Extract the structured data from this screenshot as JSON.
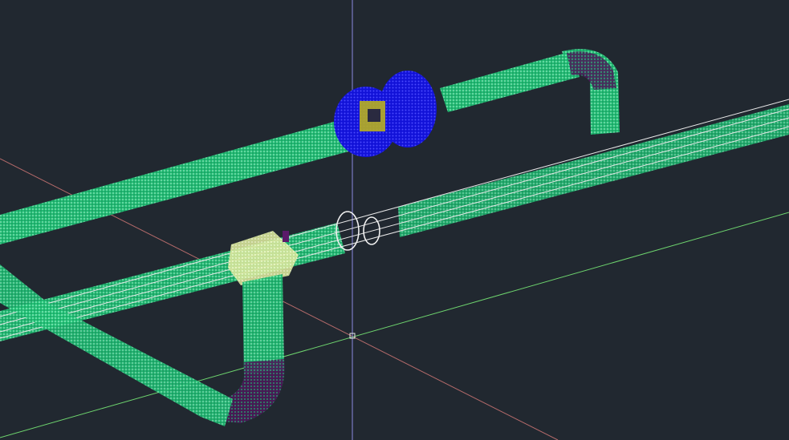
{
  "viewport": {
    "background": "#212830"
  },
  "colors": {
    "pipe_points": "#33dd88",
    "pipe_points_highlight": "#aaeecc",
    "valve_points": "#1a1aff",
    "valve_inner": "#c8c020",
    "elbow_points": "#5a1a6a",
    "tee_points": "#e6f0a0",
    "axis_x": "#c07070",
    "axis_y": "#70d070",
    "axis_z": "#8888dd",
    "model_lines": "#e8e8e8"
  },
  "icons": {
    "ucs_origin": "square-origin-marker-icon"
  }
}
